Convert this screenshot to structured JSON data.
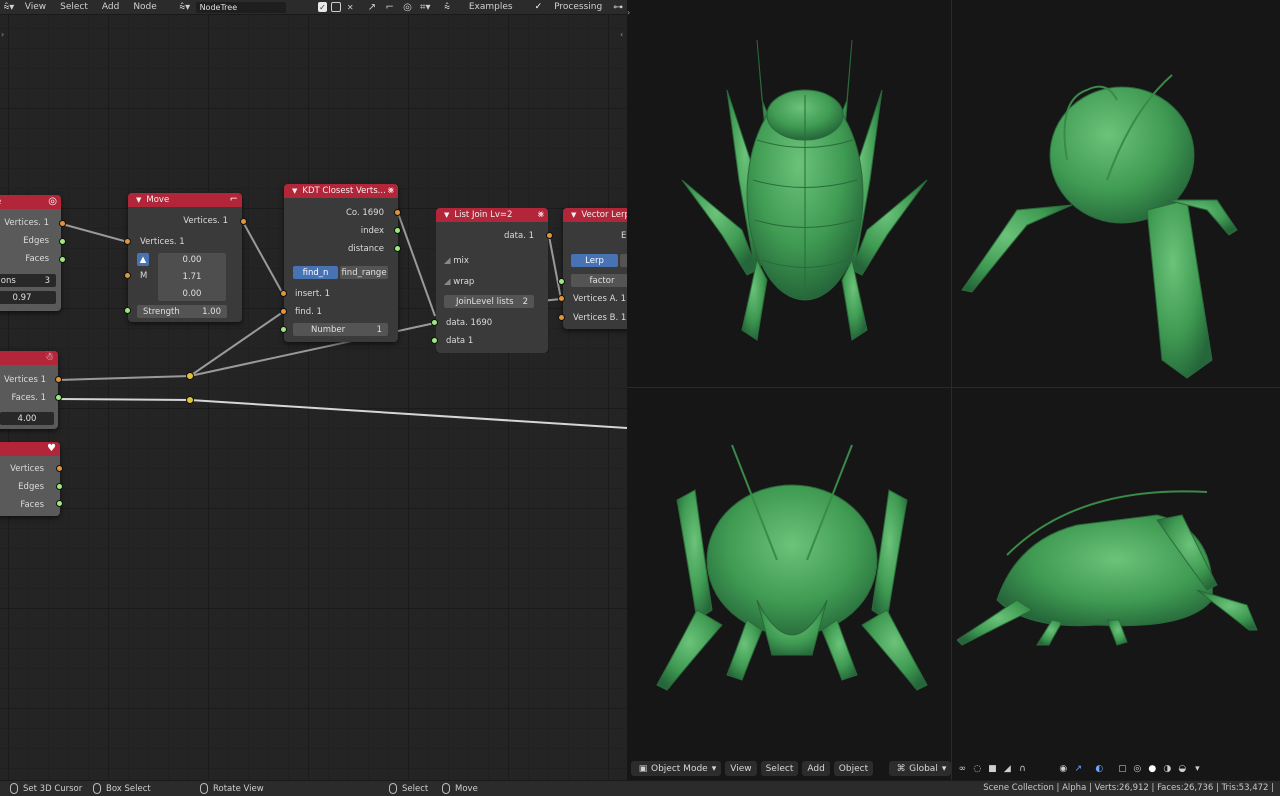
{
  "node_editor": {
    "header": {
      "editor_type_icon": "node-tree-icon",
      "menus": [
        "View",
        "Select",
        "Add",
        "Node"
      ],
      "tree_name": "NodeTree",
      "examples_label": "Examples",
      "processing_label": "Processing"
    },
    "nodes": {
      "left_top": {
        "title_fragment": "e",
        "icon": "sphere-icon",
        "outputs": [
          "Vertices. 1",
          "Edges",
          "Faces"
        ],
        "field1_label": "sions",
        "field1_value": "3",
        "field2_value": "0.97"
      },
      "move": {
        "title": "Move",
        "icon": "move-axes-icon",
        "output": "Vertices. 1",
        "input_vertices": "Vertices. 1",
        "m_label": "M",
        "vector": [
          "0.00",
          "1.71",
          "0.00"
        ],
        "strength_label": "Strength",
        "strength_value": "1.00"
      },
      "kdt": {
        "title": "KDT Closest Verts...",
        "icon": "kdt-icon",
        "outputs": [
          "Co. 1690",
          "index",
          "distance"
        ],
        "mode_find_n": "find_n",
        "mode_find_range": "find_range",
        "inputs": [
          "insert. 1",
          "find. 1"
        ],
        "number_label": "Number",
        "number_value": "1"
      },
      "list_join": {
        "title": "List Join Lv=2",
        "icon": "list-join-icon",
        "output": "data. 1",
        "mix_label": "mix",
        "wrap_label": "wrap",
        "join_level_label": "JoinLevel lists",
        "join_level_value": "2",
        "inputs": [
          "data. 1690",
          "data 1"
        ]
      },
      "vector_lerp": {
        "title": "Vector Lerp",
        "output_fragment": "E",
        "mode_label": "Lerp",
        "factor_label": "factor",
        "inputs": [
          "Vertices A. 1",
          "Vertices B. 1"
        ]
      },
      "left_mid": {
        "icon": "ghost-icon",
        "outputs": [
          "Vertices 1",
          "Faces. 1"
        ],
        "field_value": "4.00"
      },
      "left_bottom": {
        "icon": "node-type-icon",
        "outputs": [
          "Vertices",
          "Edges",
          "Faces"
        ]
      }
    }
  },
  "viewport": {
    "mesh_color": "#4aa25a",
    "header": {
      "mode": "Object Mode",
      "menus": [
        "View",
        "Select",
        "Add",
        "Object"
      ],
      "orientation": "Global"
    }
  },
  "status_bar": {
    "hints": [
      {
        "icon": "mouse-left-icon",
        "label": "Set 3D Cursor"
      },
      {
        "icon": "mouse-left-icon",
        "label": "Box Select"
      },
      {
        "icon": "mouse-middle-icon",
        "label": "Rotate View"
      },
      {
        "icon": "mouse-left-icon",
        "label": "Select"
      },
      {
        "icon": "mouse-left-icon",
        "label": "Move"
      }
    ],
    "stats": "Scene Collection | Alpha | Verts:26,912 | Faces:26,736 | Tris:53,472 |"
  }
}
